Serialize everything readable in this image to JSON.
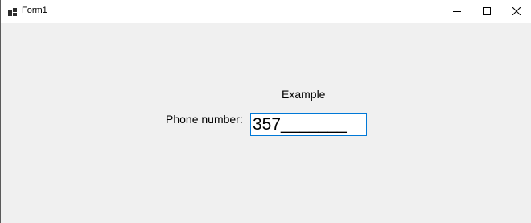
{
  "window": {
    "title": "Form1",
    "buttons": {
      "minimize_icon": "minimize-icon",
      "maximize_icon": "maximize-icon",
      "close_icon": "close-icon"
    }
  },
  "form": {
    "heading": "Example",
    "phone_label": "Phone number:",
    "phone_value": "357_______"
  },
  "colors": {
    "form_background": "#f0f0f0",
    "titlebar_background": "#ffffff",
    "input_focus_border": "#0078d7"
  }
}
